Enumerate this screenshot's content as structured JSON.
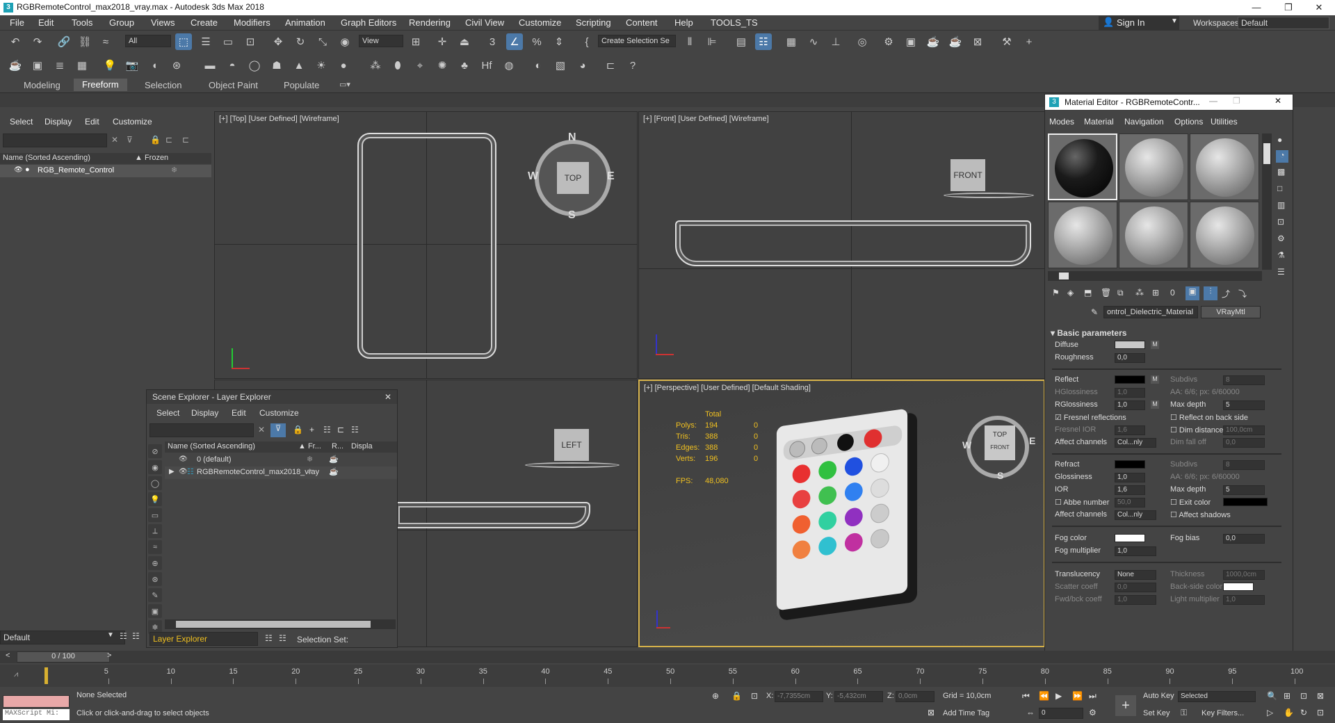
{
  "titlebar": {
    "app_icon": "3",
    "title": "RGBRemoteControl_max2018_vray.max - Autodesk 3ds Max 2018",
    "minimize": "—",
    "restore": "❐",
    "close": "✕"
  },
  "menubar": {
    "items": [
      "File",
      "Edit",
      "Tools",
      "Group",
      "Views",
      "Create",
      "Modifiers",
      "Animation",
      "Graph Editors",
      "Rendering",
      "Civil View",
      "Customize",
      "Scripting",
      "Content",
      "Help",
      "TOOLS_TS"
    ],
    "signin": "Sign In",
    "workspaces_label": "Workspaces:",
    "workspace_value": "Default"
  },
  "toolbar": {
    "filter_all": "All",
    "view_ref": "View",
    "create_selection": "Create Selection Se"
  },
  "ribbon": {
    "tabs": [
      "Modeling",
      "Freeform",
      "Selection",
      "Object Paint",
      "Populate"
    ]
  },
  "left_panel": {
    "menu": [
      "Select",
      "Display",
      "Edit",
      "Customize"
    ],
    "col_name": "Name (Sorted Ascending)",
    "col_frozen": "▲ Frozen",
    "row_name": "RGB_Remote_Control",
    "bottom_value": "Default"
  },
  "viewports": {
    "top": "[+] [Top] [User Defined] [Wireframe]",
    "front": "[+] [Front] [User Defined] [Wireframe]",
    "left": "",
    "persp": "[+] [Perspective] [User Defined] [Default Shading]",
    "viewcube_top": "TOP",
    "viewcube_front": "FRONT",
    "viewcube_left": "LEFT",
    "viewcube_front_small": "FRONT",
    "compass": {
      "n": "N",
      "s": "S",
      "e": "E",
      "w": "W"
    },
    "stats": {
      "header": "Total",
      "rows": [
        [
          "Polys:",
          "194",
          "0"
        ],
        [
          "Tris:",
          "388",
          "0"
        ],
        [
          "Edges:",
          "388",
          "0"
        ],
        [
          "Verts:",
          "196",
          "0"
        ]
      ],
      "fps_label": "FPS:",
      "fps_value": "48,080"
    }
  },
  "scene_explorer": {
    "title": "Scene Explorer - Layer Explorer",
    "close": "✕",
    "menu": [
      "Select",
      "Display",
      "Edit",
      "Customize"
    ],
    "col_name": "Name (Sorted Ascending)",
    "col_fr": "▲ Fr...",
    "col_r": "R...",
    "col_disp": "Displa",
    "rows": [
      "0 (default)",
      "RGBRemoteControl_max2018_vray"
    ],
    "bottom_value": "Layer Explorer",
    "selection_set": "Selection Set:"
  },
  "material_editor": {
    "title": "Material Editor - RGBRemoteContr...",
    "menu": [
      "Modes",
      "Material",
      "Navigation",
      "Options",
      "Utilities"
    ],
    "mat_name": "ontrol_Dielectric_Material",
    "mat_type": "VRayMtl",
    "section": "Basic parameters",
    "diffuse": "Diffuse",
    "diffuse_color": "#c8c8c8",
    "m": "M",
    "roughness": "Roughness",
    "roughness_val": "0,0",
    "reflect": "Reflect",
    "reflect_color": "#000000",
    "subdivs": "Subdivs",
    "subdivs_val": "8",
    "hglossiness": "HGlossiness",
    "hgl_val": "1,0",
    "aa": "AA: 6/6; px: 6/60000",
    "rglossiness": "RGlossiness",
    "rgl_val": "1,0",
    "max_depth": "Max depth",
    "max_depth_val": "5",
    "fresnel": "Fresnel reflections",
    "reflect_back": "Reflect on back side",
    "fresnel_ior": "Fresnel IOR",
    "fior_val": "1,6",
    "dim_distance": "Dim distance",
    "dim_val": "100,0cm",
    "affect_channels": "Affect channels",
    "affect_val": "Col...nly",
    "dim_falloff": "Dim fall off",
    "dim_falloff_val": "0,0",
    "refract": "Refract",
    "refract_color": "#000000",
    "subdivs2_val": "8",
    "glossiness": "Glossiness",
    "gloss_val": "1,0",
    "aa2": "AA: 6/6; px: 6/60000",
    "ior": "IOR",
    "ior_val": "1,6",
    "max_depth2_val": "5",
    "abbe": "Abbe number",
    "abbe_val": "50,0",
    "exit_color": "Exit color",
    "exit_color_val": "#000000",
    "affect_channels2_val": "Col...nly",
    "affect_shadows": "Affect shadows",
    "fog_color": "Fog color",
    "fog_color_val": "#ffffff",
    "fog_bias": "Fog bias",
    "fog_bias_val": "0,0",
    "fog_mult": "Fog multiplier",
    "fog_mult_val": "1,0",
    "translucency": "Translucency",
    "trans_val": "None",
    "thickness": "Thickness",
    "thickness_val": "1000,0cm",
    "scatter": "Scatter coeff",
    "scatter_val": "0,0",
    "backside": "Back-side color",
    "backside_val": "#ffffff",
    "fwd": "Fwd/bck coeff",
    "fwd_val": "1,0",
    "light_mult": "Light multiplier",
    "light_mult_val": "1,0"
  },
  "timeline": {
    "frame": "0 / 100",
    "ticks": [
      "5",
      "10",
      "15",
      "20",
      "25",
      "30",
      "35",
      "40",
      "45",
      "50",
      "55",
      "60",
      "65",
      "70",
      "75",
      "80",
      "85",
      "90",
      "95",
      "100"
    ]
  },
  "status": {
    "maxscript": "MAXScript Mi:",
    "none_selected": "None Selected",
    "prompt": "Click or click-and-drag to select objects",
    "x_label": "X:",
    "x_val": "-7,7355cm",
    "y_label": "Y:",
    "y_val": "-5,432cm",
    "z_label": "Z:",
    "z_val": "0,0cm",
    "grid": "Grid = 10,0cm",
    "add_time_tag": "Add Time Tag",
    "frame_val": "0",
    "auto_key": "Auto Key",
    "set_key": "Set Key",
    "selected": "Selected",
    "key_filters": "Key Filters..."
  }
}
